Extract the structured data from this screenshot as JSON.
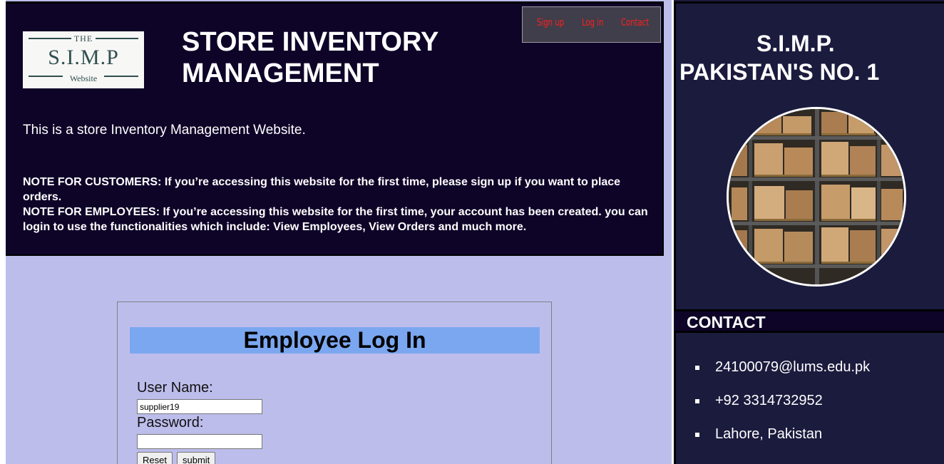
{
  "logo": {
    "top_text": "THE",
    "main_text": "S.I.M.P",
    "sub_text": "Website"
  },
  "header": {
    "title": "STORE INVENTORY MANAGEMENT",
    "intro": "This is a store Inventory Management Website.",
    "note_customers": "NOTE FOR CUSTOMERS: If you’re accessing this website for the first time, please sign up if you want to place orders.",
    "note_employees": "NOTE FOR EMPLOYEES: If you’re accessing this website for the first time, your account has been created. you can login to use the functionalities which include: View Employees, View Orders and much more."
  },
  "nav": {
    "signup": "Sign up",
    "login": "Log in",
    "contact": "Contact",
    "link_color": "#ff1f1f"
  },
  "login_form": {
    "title": "Employee Log In",
    "username_label": "User Name:",
    "username_value": "supplier19",
    "password_label": "Password:",
    "password_value": "",
    "reset_label": "Reset",
    "submit_label": "submit"
  },
  "sidebar": {
    "brand_line1": "S.I.M.P.",
    "brand_line2": "PAKISTAN'S NO. 1",
    "image_icon": "warehouse-shelves-photo",
    "contact_title": "CONTACT",
    "contacts": [
      "24100079@lums.edu.pk",
      "+92 3314732952",
      "Lahore, Pakistan"
    ]
  },
  "colors": {
    "header_bg": "#0e0428",
    "page_bg": "#bdbdec",
    "sidebar_bg": "#1b1b3e",
    "login_title_bg": "#7ba7f0"
  }
}
